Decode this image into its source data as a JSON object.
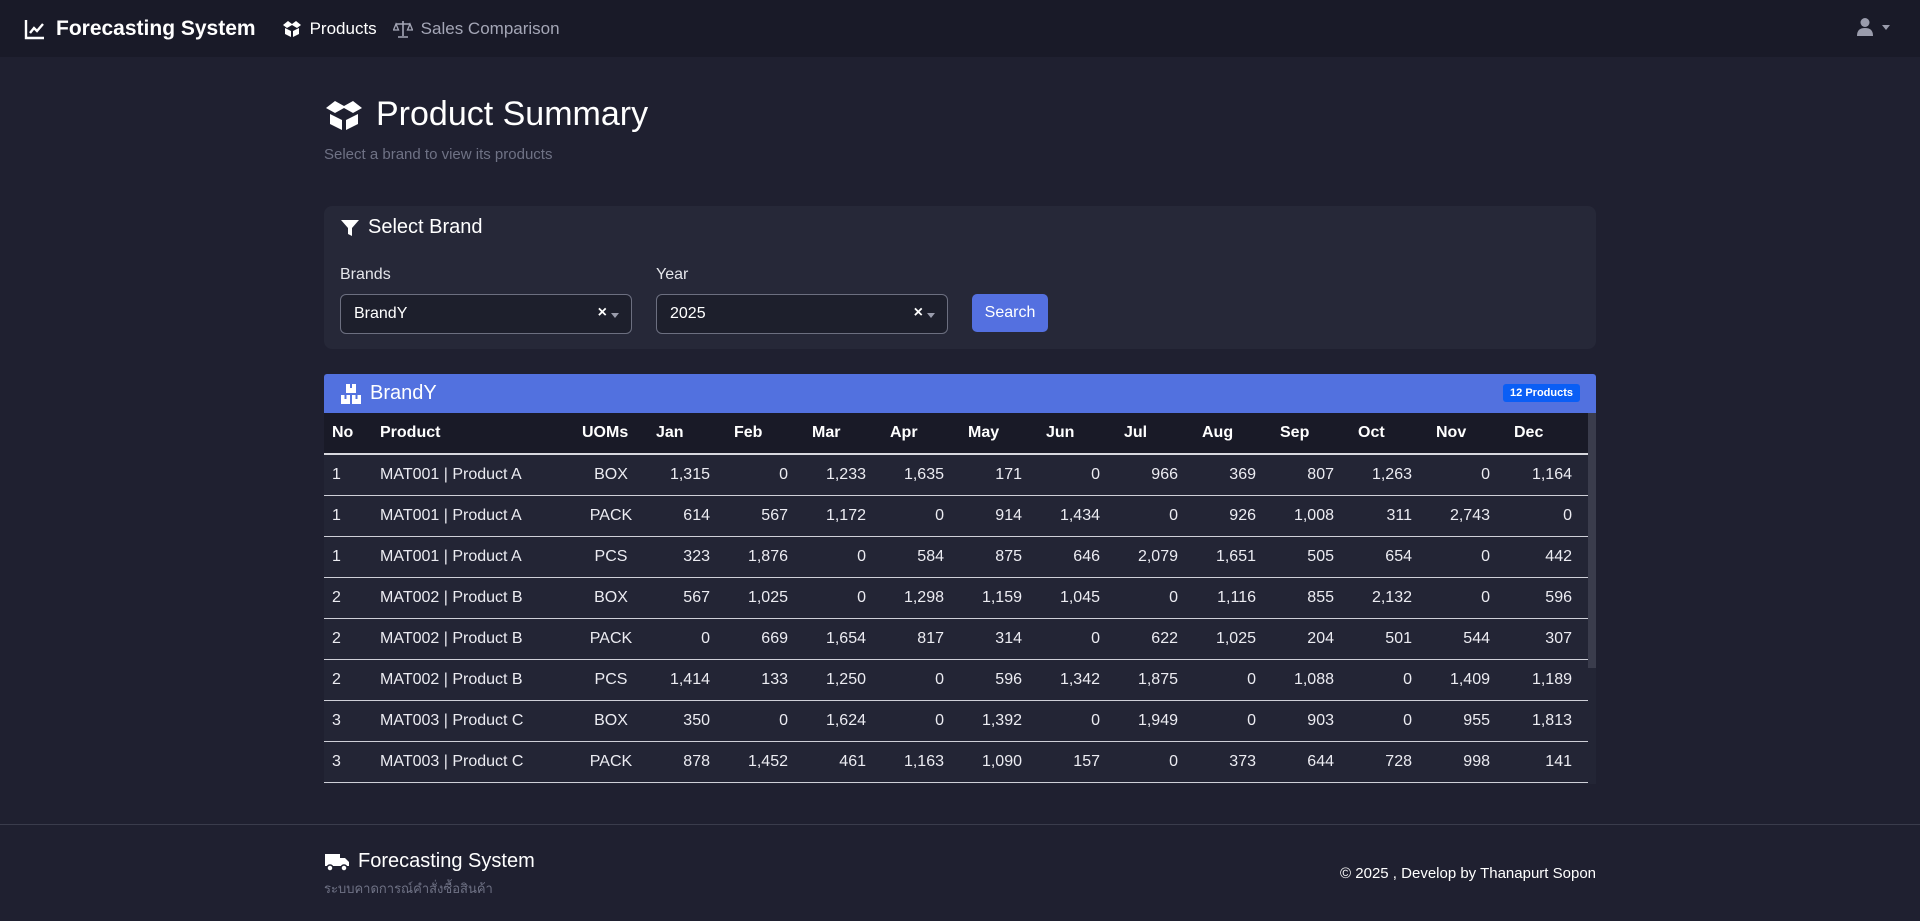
{
  "nav": {
    "brand": "Forecasting System",
    "links": [
      {
        "label": "Products",
        "icon": "box-open-icon"
      },
      {
        "label": "Sales Comparison",
        "icon": "scale-icon"
      }
    ]
  },
  "header": {
    "title": "Product Summary",
    "subtitle": "Select a brand to view its products"
  },
  "filter": {
    "title": "Select Brand",
    "brand_label": "Brands",
    "brand_value": "BrandY",
    "year_label": "Year",
    "year_value": "2025",
    "clear_symbol": "×",
    "search_label": "Search"
  },
  "table": {
    "brand_title": "BrandY",
    "badge": "12 Products",
    "columns": [
      "No",
      "Product",
      "UOMs",
      "Jan",
      "Feb",
      "Mar",
      "Apr",
      "May",
      "Jun",
      "Jul",
      "Aug",
      "Sep",
      "Oct",
      "Nov",
      "Dec"
    ],
    "rows": [
      [
        "1",
        "MAT001 | Product A",
        "BOX",
        "1,315",
        "0",
        "1,233",
        "1,635",
        "171",
        "0",
        "966",
        "369",
        "807",
        "1,263",
        "0",
        "1,164"
      ],
      [
        "1",
        "MAT001 | Product A",
        "PACK",
        "614",
        "567",
        "1,172",
        "0",
        "914",
        "1,434",
        "0",
        "926",
        "1,008",
        "311",
        "2,743",
        "0"
      ],
      [
        "1",
        "MAT001 | Product A",
        "PCS",
        "323",
        "1,876",
        "0",
        "584",
        "875",
        "646",
        "2,079",
        "1,651",
        "505",
        "654",
        "0",
        "442"
      ],
      [
        "2",
        "MAT002 | Product B",
        "BOX",
        "567",
        "1,025",
        "0",
        "1,298",
        "1,159",
        "1,045",
        "0",
        "1,116",
        "855",
        "2,132",
        "0",
        "596"
      ],
      [
        "2",
        "MAT002 | Product B",
        "PACK",
        "0",
        "669",
        "1,654",
        "817",
        "314",
        "0",
        "622",
        "1,025",
        "204",
        "501",
        "544",
        "307"
      ],
      [
        "2",
        "MAT002 | Product B",
        "PCS",
        "1,414",
        "133",
        "1,250",
        "0",
        "596",
        "1,342",
        "1,875",
        "0",
        "1,088",
        "0",
        "1,409",
        "1,189"
      ],
      [
        "3",
        "MAT003 | Product C",
        "BOX",
        "350",
        "0",
        "1,624",
        "0",
        "1,392",
        "0",
        "1,949",
        "0",
        "903",
        "0",
        "955",
        "1,813"
      ],
      [
        "3",
        "MAT003 | Product C",
        "PACK",
        "878",
        "1,452",
        "461",
        "1,163",
        "1,090",
        "157",
        "0",
        "373",
        "644",
        "728",
        "998",
        "141"
      ]
    ]
  },
  "footer": {
    "brand": "Forecasting System",
    "subtitle": "ระบบคาดการณ์คำสั่งซื้อสินค้า",
    "copyright": "© 2025 , Develop by Thanapurt Sopon"
  },
  "colors": {
    "background": "#1f2030",
    "navbar": "#191a28",
    "accent": "#5271df",
    "badge": "#0a5ef5"
  }
}
